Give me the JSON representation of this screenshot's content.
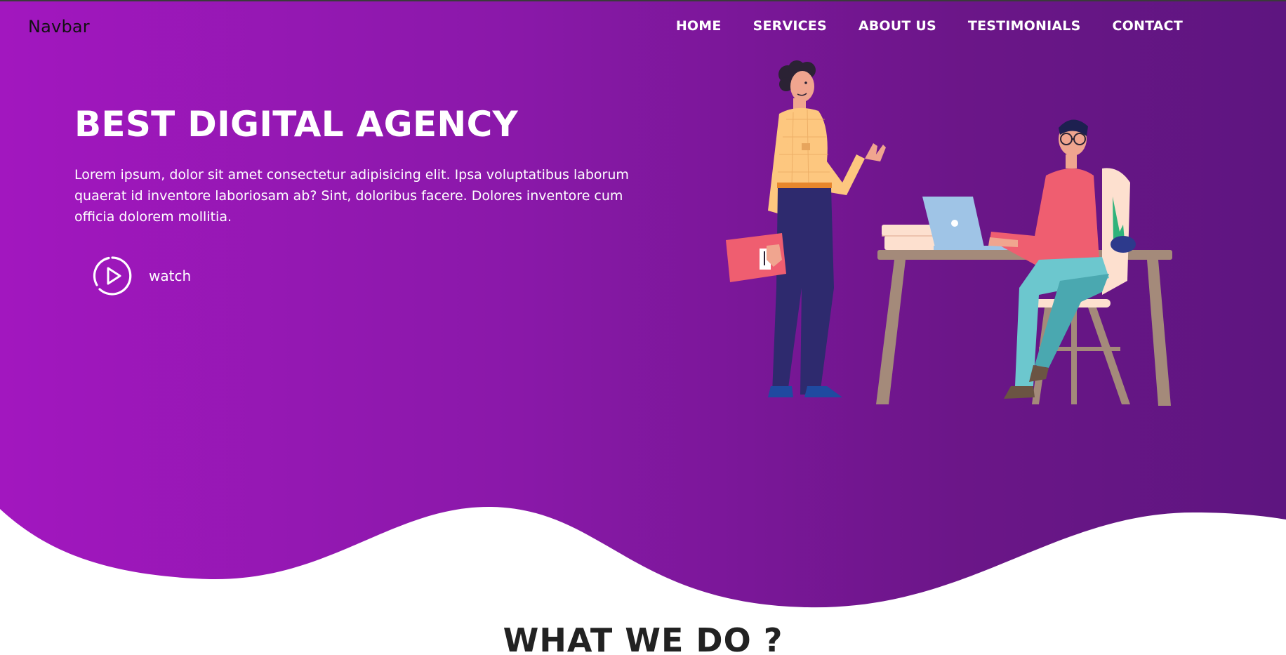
{
  "navbar": {
    "brand": "Navbar",
    "links": [
      "HOME",
      "SERVICES",
      "ABOUT US",
      "TESTIMONIALS",
      "CONTACT"
    ]
  },
  "hero": {
    "title": "BEST DIGITAL AGENCY",
    "text": "Lorem ipsum, dolor sit amet consectetur adipisicing elit. Ipsa voluptatibus laborum quaerat id inventore laboriosam ab? Sint, doloribus facere. Dolores inventore cum officia dolorem mollitia.",
    "watch_label": "watch",
    "illustration": "two-people-office-illustration"
  },
  "section": {
    "title": "WHAT WE DO ?"
  },
  "colors": {
    "gradient_start": "#a217bf",
    "gradient_end": "#5e1580",
    "text_light": "#ffffff",
    "brand_text": "#111111"
  },
  "icons": {
    "play": "play-circle-icon"
  }
}
